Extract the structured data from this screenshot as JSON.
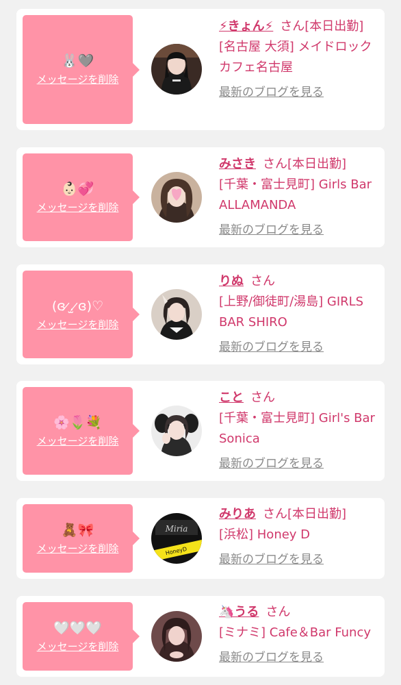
{
  "items": [
    {
      "stamp": "🐰🩶",
      "delete_label": "メッセージを削除",
      "name": "⚡きょん⚡",
      "suffix": "さん",
      "status": "[本日出勤]",
      "shop": "[名古屋 大須] メイドロックカフェ名古屋",
      "blog_label": "最新のブログを見る"
    },
    {
      "stamp": "👶🏻💞",
      "delete_label": "メッセージを削除",
      "name": "みさき",
      "suffix": "さん",
      "status": "[本日出勤]",
      "shop": "[千葉・富士見町] Girls Bar ALLAMANDA",
      "blog_label": "最新のブログを見る"
    },
    {
      "stamp": "(ɞ ̷.̫ ̷ɞ)♡",
      "delete_label": "メッセージを削除",
      "name": "りぬ",
      "suffix": "さん",
      "status": "",
      "shop": "[上野/御徒町/湯島] GIRLS BAR SHIRO",
      "blog_label": "最新のブログを見る"
    },
    {
      "stamp": "🌸🌷💐",
      "delete_label": "メッセージを削除",
      "name": "こと",
      "suffix": "さん",
      "status": "",
      "shop": "[千葉・富士見町] Girl's Bar Sonica",
      "blog_label": "最新のブログを見る"
    },
    {
      "stamp": "🧸🎀",
      "delete_label": "メッセージを削除",
      "name": "みりあ",
      "suffix": "さん",
      "status": "[本日出勤]",
      "shop": "[浜松] Honey D",
      "blog_label": "最新のブログを見る"
    },
    {
      "stamp": "🤍🤍🤍",
      "delete_label": "メッセージを削除",
      "name": "🦄うる",
      "suffix": "さん",
      "status": "",
      "shop": "[ミナミ] Cafe＆Bar Funcy",
      "blog_label": "最新のブログを見る"
    }
  ],
  "colors": {
    "background": "#f1f1f1",
    "card": "#ffffff",
    "bubble": "#ff93a7",
    "accent": "#d0386b",
    "link_gray": "#8a8a8a"
  }
}
